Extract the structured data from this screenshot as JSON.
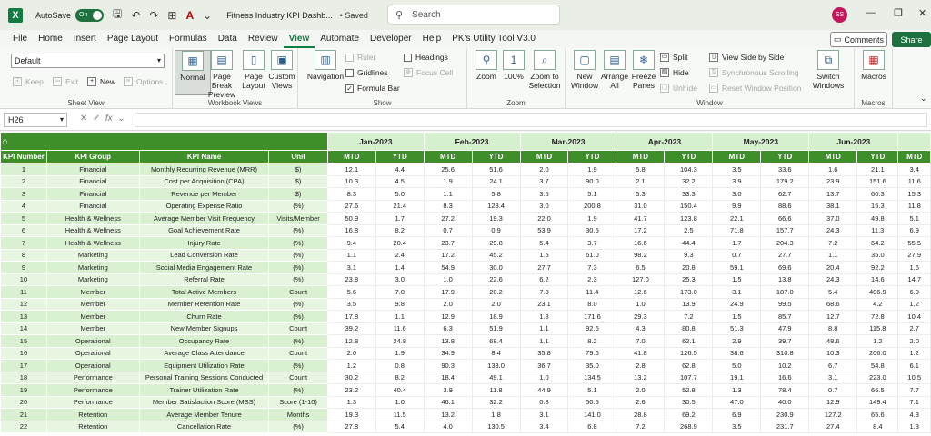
{
  "titlebar": {
    "autosave_label": "AutoSave",
    "autosave_state": "On",
    "doc_title": "Fitness Industry KPI Dashb...",
    "saved": "• Saved",
    "search_placeholder": "Search",
    "avatar_initials": "SS"
  },
  "tabs": [
    "File",
    "Home",
    "Insert",
    "Page Layout",
    "Formulas",
    "Data",
    "Review",
    "View",
    "Automate",
    "Developer",
    "Help",
    "PK's Utility Tool V3.0"
  ],
  "active_tab": "View",
  "top_right": {
    "comments": "Comments",
    "share": "Share"
  },
  "ribbon": {
    "sheet_view": {
      "select_value": "Default",
      "keep": "Keep",
      "exit": "Exit",
      "new": "New",
      "options": "Options",
      "label": "Sheet View"
    },
    "workbook_views": {
      "normal": "Normal",
      "page_break": "Page Break Preview",
      "page_layout": "Page Layout",
      "custom": "Custom Views",
      "label": "Workbook Views"
    },
    "show": {
      "navigation": "Navigation",
      "ruler": "Ruler",
      "gridlines": "Gridlines",
      "formula_bar": "Formula Bar",
      "headings": "Headings",
      "focus_cell": "Focus Cell",
      "label": "Show"
    },
    "zoom": {
      "zoom": "Zoom",
      "hundred": "100%",
      "zoom_to_selection": "Zoom to Selection",
      "label": "Zoom"
    },
    "window": {
      "new_window": "New Window",
      "arrange_all": "Arrange All",
      "freeze_panes": "Freeze Panes",
      "split": "Split",
      "hide": "Hide",
      "unhide": "Unhide",
      "view_side_by_side": "View Side by Side",
      "sync_scroll": "Synchronous Scrolling",
      "reset_position": "Reset Window Position",
      "switch_windows": "Switch Windows",
      "label": "Window"
    },
    "macros": {
      "macros": "Macros",
      "label": "Macros"
    }
  },
  "formula_bar": {
    "name_box": "H26",
    "formula": ""
  },
  "sheet": {
    "headers": [
      "KPI Number",
      "KPI Group",
      "KPI Name",
      "Unit"
    ],
    "months": [
      "Jan-2023",
      "Feb-2023",
      "Mar-2023",
      "Apr-2023",
      "May-2023",
      "Jun-2023"
    ],
    "sub_headers": [
      "MTD",
      "YTD"
    ],
    "extra_sub": "MTD",
    "rows": [
      {
        "n": "1",
        "g": "Financial",
        "k": "Monthly Recurring Revenue (MRR)",
        "u": "$)",
        "v": [
          "12.1",
          "4.4",
          "25.6",
          "51.6",
          "2.0",
          "1.9",
          "5.8",
          "104.3",
          "3.5",
          "33.6",
          "1.6",
          "21.1",
          "3.4"
        ]
      },
      {
        "n": "2",
        "g": "Financial",
        "k": "Cost per Acquisition (CPA)",
        "u": "$)",
        "v": [
          "10.3",
          "4.5",
          "1.9",
          "24.1",
          "3.7",
          "90.0",
          "2.1",
          "32.2",
          "3.9",
          "179.2",
          "23.9",
          "151.6",
          "11.6"
        ]
      },
      {
        "n": "3",
        "g": "Financial",
        "k": "Revenue per Member",
        "u": "$)",
        "v": [
          "8.3",
          "5.0",
          "1.1",
          "5.8",
          "3.5",
          "5.1",
          "5.3",
          "33.3",
          "3.0",
          "62.7",
          "13.7",
          "60.3",
          "15.3"
        ]
      },
      {
        "n": "4",
        "g": "Financial",
        "k": "Operating Expense Ratio",
        "u": "(%)",
        "v": [
          "27.6",
          "21.4",
          "8.3",
          "128.4",
          "3.0",
          "200.8",
          "31.0",
          "150.4",
          "9.9",
          "88.6",
          "38.1",
          "15.3",
          "11.8"
        ]
      },
      {
        "n": "5",
        "g": "Health & Wellness",
        "k": "Average Member Visit Frequency",
        "u": "Visits/Member",
        "v": [
          "50.9",
          "1.7",
          "27.2",
          "19.3",
          "22.0",
          "1.9",
          "41.7",
          "123.8",
          "22.1",
          "66.6",
          "37.0",
          "49.8",
          "5.1"
        ]
      },
      {
        "n": "6",
        "g": "Health & Wellness",
        "k": "Goal Achievement Rate",
        "u": "(%)",
        "v": [
          "16.8",
          "8.2",
          "0.7",
          "0.9",
          "53.9",
          "30.5",
          "17.2",
          "2.5",
          "71.8",
          "157.7",
          "24.3",
          "11.3",
          "6.9"
        ]
      },
      {
        "n": "7",
        "g": "Health & Wellness",
        "k": "Injury Rate",
        "u": "(%)",
        "v": [
          "9.4",
          "20.4",
          "23.7",
          "29.8",
          "5.4",
          "3.7",
          "16.6",
          "44.4",
          "1.7",
          "204.3",
          "7.2",
          "64.2",
          "55.5"
        ]
      },
      {
        "n": "8",
        "g": "Marketing",
        "k": "Lead Conversion Rate",
        "u": "(%)",
        "v": [
          "1.1",
          "2.4",
          "17.2",
          "45.2",
          "1.5",
          "61.0",
          "98.2",
          "9.3",
          "0.7",
          "27.7",
          "1.1",
          "35.0",
          "27.9"
        ]
      },
      {
        "n": "9",
        "g": "Marketing",
        "k": "Social Media Engagement Rate",
        "u": "(%)",
        "v": [
          "3.1",
          "1.4",
          "54.9",
          "30.0",
          "27.7",
          "7.3",
          "6.5",
          "20.8",
          "59.1",
          "69.6",
          "20.4",
          "92.2",
          "1.6"
        ]
      },
      {
        "n": "10",
        "g": "Marketing",
        "k": "Referral Rate",
        "u": "(%)",
        "v": [
          "23.8",
          "3.0",
          "1.0",
          "22.6",
          "6.2",
          "2.3",
          "127.0",
          "25.3",
          "1.5",
          "13.8",
          "24.3",
          "14.6",
          "14.7"
        ]
      },
      {
        "n": "11",
        "g": "Member",
        "k": "Total Active Members",
        "u": "Count",
        "v": [
          "5.6",
          "7.0",
          "17.9",
          "20.2",
          "7.8",
          "11.4",
          "12.6",
          "173.0",
          "3.1",
          "187.0",
          "5.4",
          "406.9",
          "6.9"
        ]
      },
      {
        "n": "12",
        "g": "Member",
        "k": "Member Retention Rate",
        "u": "(%)",
        "v": [
          "3.5",
          "9.8",
          "2.0",
          "2.0",
          "23.1",
          "8.0",
          "1.0",
          "13.9",
          "24.9",
          "99.5",
          "68.6",
          "4.2",
          "1.2"
        ]
      },
      {
        "n": "13",
        "g": "Member",
        "k": "Churn Rate",
        "u": "(%)",
        "v": [
          "17.8",
          "1.1",
          "12.9",
          "18.9",
          "1.8",
          "171.6",
          "29.3",
          "7.2",
          "1.5",
          "85.7",
          "12.7",
          "72.8",
          "10.4"
        ]
      },
      {
        "n": "14",
        "g": "Member",
        "k": "New Member Signups",
        "u": "Count",
        "v": [
          "39.2",
          "11.6",
          "6.3",
          "51.9",
          "1.1",
          "92.6",
          "4.3",
          "80.8",
          "51.3",
          "47.9",
          "8.8",
          "115.8",
          "2.7"
        ]
      },
      {
        "n": "15",
        "g": "Operational",
        "k": "Occupancy Rate",
        "u": "(%)",
        "v": [
          "12.8",
          "24.8",
          "13.8",
          "68.4",
          "1.1",
          "8.2",
          "7.0",
          "62.1",
          "2.9",
          "39.7",
          "48.6",
          "1.2",
          "2.0"
        ]
      },
      {
        "n": "16",
        "g": "Operational",
        "k": "Average Class Attendance",
        "u": "Count",
        "v": [
          "2.0",
          "1.9",
          "34.9",
          "8.4",
          "35.8",
          "79.6",
          "41.8",
          "126.5",
          "38.6",
          "310.8",
          "10.3",
          "206.0",
          "1.2"
        ]
      },
      {
        "n": "17",
        "g": "Operational",
        "k": "Equipment Utilization Rate",
        "u": "(%)",
        "v": [
          "1.2",
          "0.8",
          "90.3",
          "133.0",
          "36.7",
          "35.0",
          "2.8",
          "62.8",
          "5.0",
          "10.2",
          "6.7",
          "54.8",
          "6.1"
        ]
      },
      {
        "n": "18",
        "g": "Performance",
        "k": "Personal Training Sessions Conducted",
        "u": "Count",
        "v": [
          "30.2",
          "8.2",
          "18.4",
          "49.1",
          "1.0",
          "134.5",
          "13.2",
          "107.7",
          "19.1",
          "16.6",
          "3.1",
          "223.0",
          "10.5"
        ]
      },
      {
        "n": "19",
        "g": "Performance",
        "k": "Trainer Utilization Rate",
        "u": "(%)",
        "v": [
          "23.2",
          "40.4",
          "3.9",
          "11.8",
          "44.9",
          "5.1",
          "2.0",
          "52.8",
          "1.3",
          "78.4",
          "0.7",
          "66.5",
          "7.7"
        ]
      },
      {
        "n": "20",
        "g": "Performance",
        "k": "Member Satisfaction Score (MSS)",
        "u": "Score (1-10)",
        "v": [
          "1.3",
          "1.0",
          "46.1",
          "32.2",
          "0.8",
          "50.5",
          "2.6",
          "30.5",
          "47.0",
          "40.0",
          "12.9",
          "149.4",
          "7.1"
        ]
      },
      {
        "n": "21",
        "g": "Retention",
        "k": "Average Member Tenure",
        "u": "Months",
        "v": [
          "19.3",
          "11.5",
          "13.2",
          "1.8",
          "3.1",
          "141.0",
          "28.8",
          "69.2",
          "6.9",
          "230.9",
          "127.2",
          "65.6",
          "4.3"
        ]
      },
      {
        "n": "22",
        "g": "Retention",
        "k": "Cancellation Rate",
        "u": "(%)",
        "v": [
          "27.8",
          "5.4",
          "4.0",
          "130.5",
          "3.4",
          "6.8",
          "7.2",
          "268.9",
          "3.5",
          "231.7",
          "27.4",
          "8.4",
          "1.3"
        ]
      }
    ]
  }
}
